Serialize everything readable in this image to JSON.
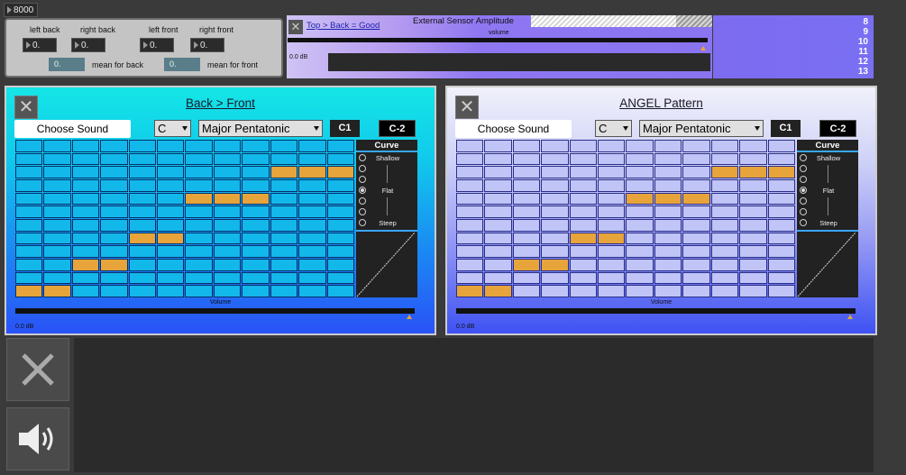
{
  "top_number": "8000",
  "sensor": {
    "labels": [
      "left back",
      "right back",
      "left front",
      "right front"
    ],
    "values": [
      "0.",
      "0.",
      "0.",
      "0."
    ],
    "mean_back_value": "0.",
    "mean_back_label": "mean for back",
    "mean_front_value": "0.",
    "mean_front_label": "mean for front"
  },
  "amplitude": {
    "title": "External Sensor Amplitude",
    "top_link": "Top > Back = Good",
    "volume_label": "volume",
    "db": "0.0 dB",
    "channel_numbers": [
      "8",
      "9",
      "10",
      "11",
      "12",
      "13"
    ]
  },
  "panels": [
    {
      "title": "Back > Front",
      "choose_sound": "Choose Sound",
      "key": "C",
      "scale": "Major Pentatonic",
      "octave_low": "C1",
      "octave_high": "C-2",
      "curve_title": "Curve",
      "curve_labels": [
        "Shallow",
        "Flat",
        "Steep"
      ],
      "volume_label": "Volume",
      "db": "0.0 dB",
      "active_cells": [
        [
          2,
          9
        ],
        [
          2,
          10
        ],
        [
          2,
          11
        ],
        [
          4,
          6
        ],
        [
          4,
          7
        ],
        [
          4,
          8
        ],
        [
          7,
          4
        ],
        [
          7,
          5
        ],
        [
          9,
          2
        ],
        [
          9,
          3
        ],
        [
          11,
          0
        ],
        [
          11,
          1
        ]
      ]
    },
    {
      "title": "ANGEL Pattern",
      "choose_sound": "Choose Sound",
      "key": "C",
      "scale": "Major Pentatonic",
      "octave_low": "C1",
      "octave_high": "C-2",
      "curve_title": "Curve",
      "curve_labels": [
        "Shallow",
        "Flat",
        "Steep"
      ],
      "volume_label": "Volume",
      "db": "0.0 dB",
      "active_cells": [
        [
          2,
          9
        ],
        [
          2,
          10
        ],
        [
          2,
          11
        ],
        [
          4,
          6
        ],
        [
          4,
          7
        ],
        [
          4,
          8
        ],
        [
          7,
          4
        ],
        [
          7,
          5
        ],
        [
          9,
          2
        ],
        [
          9,
          3
        ],
        [
          11,
          0
        ],
        [
          11,
          1
        ]
      ]
    }
  ],
  "colors": {
    "active_cell": "#e6a43a",
    "left_panel_top": "#14e6e6",
    "right_panel_top": "#f1f1fb"
  },
  "icons": {
    "close": "close-icon",
    "speaker": "speaker-icon"
  }
}
